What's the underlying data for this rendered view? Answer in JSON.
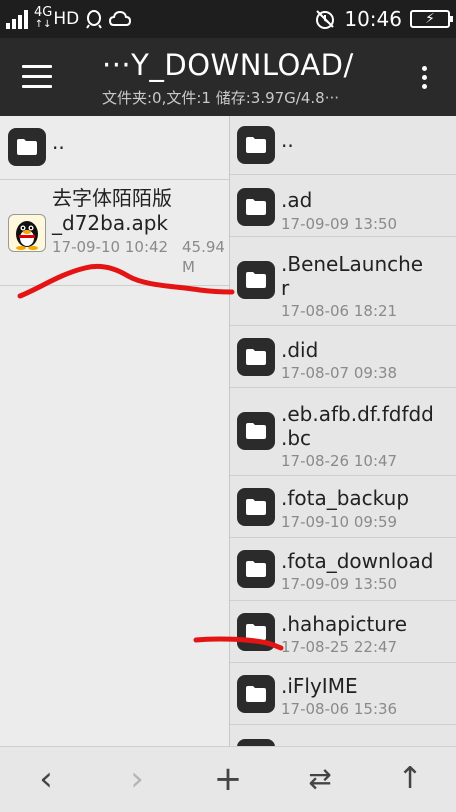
{
  "status_bar": {
    "network": "4G",
    "hd": "HD",
    "time": "10:46"
  },
  "app_bar": {
    "title": "···Y_DOWNLOAD/",
    "subtitle": "文件夹:0,文件:1  储存:3.97G/4.8···"
  },
  "left_pane": {
    "parent": "..",
    "files": [
      {
        "name_line1": "去字体陌陌版",
        "name_line2": "_d72ba.apk",
        "date": "17-09-10 10:42",
        "size_line1": "45.94",
        "size_line2": "M",
        "icon": "qq-penguin-icon"
      }
    ]
  },
  "right_pane": {
    "parent": "..",
    "folders": [
      {
        "name": ".ad",
        "date": "17-09-09 13:50"
      },
      {
        "name": ".BeneLauncher",
        "line1": ".BeneLaunche",
        "line2": "r",
        "date": "17-08-06 18:21"
      },
      {
        "name": ".did",
        "date": "17-08-07 09:38"
      },
      {
        "name": ".eb.afb.df.fdfdd.bc",
        "line1": ".eb.afb.df.fdfdd",
        "line2": ".bc",
        "date": "17-08-26 10:47"
      },
      {
        "name": ".fota_backup",
        "date": "17-09-10 09:59"
      },
      {
        "name": ".fota_download",
        "date": "17-09-09 13:50"
      },
      {
        "name": ".hahapicture",
        "date": "17-08-25 22:47"
      },
      {
        "name": ".iFlyIME",
        "date": "17-08-06 15:36"
      }
    ]
  },
  "bottom_bar": {
    "back": "‹",
    "forward": "›",
    "add": "+",
    "swap": "⇄",
    "up": "↑"
  },
  "colors": {
    "appbar": "#2a2a2a",
    "statusbar": "#1e1e1e",
    "folder_icon": "#2b2b2b",
    "annotation": "#e41414"
  }
}
